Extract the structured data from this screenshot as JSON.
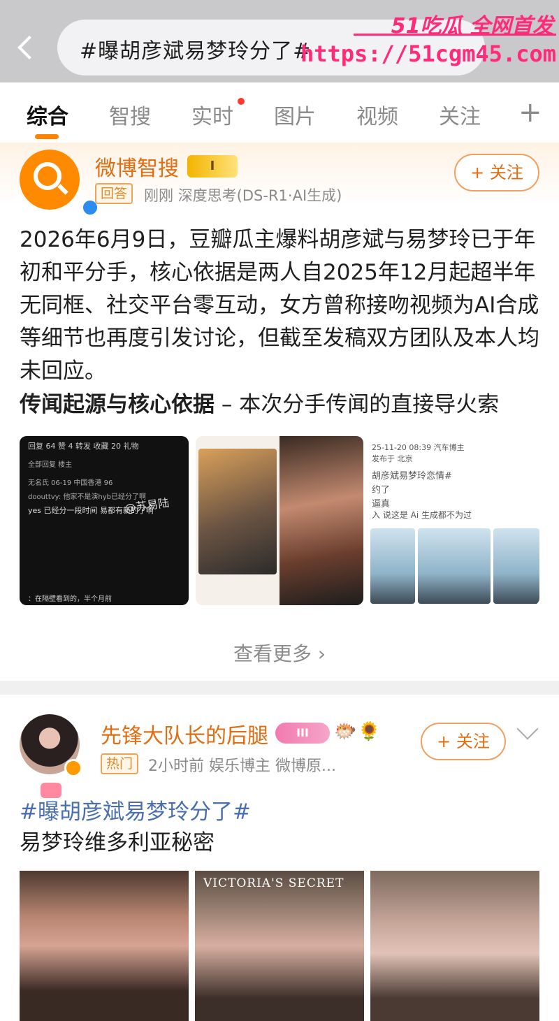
{
  "search": {
    "query": "#曝胡彦斌易梦玲分了#"
  },
  "watermark": {
    "brand": "51吃瓜 全网首发",
    "url": "https://51cgm45.com"
  },
  "tabs": [
    {
      "label": "综合"
    },
    {
      "label": "智搜"
    },
    {
      "label": "实时"
    },
    {
      "label": "图片"
    },
    {
      "label": "视频"
    },
    {
      "label": "关注"
    }
  ],
  "tab_plus": "+",
  "colors": {
    "accent": "#ff8200",
    "name": "#e06d12",
    "hashtag": "#4a6fb0",
    "watermark": "#ff2a7a"
  },
  "post1": {
    "author": "微博智搜",
    "badge": "I",
    "tag": "回答",
    "meta": "刚刚 深度思考(DS-R1·AI生成)",
    "follow_label": "+ 关注",
    "body": "2026年6月9日，豆瓣瓜主爆料胡彦斌与易梦玲已于年初和平分手，核心依据是两人自2025年12月起超半年无同框、社交平台零互动，女方曾称接吻视频为AI合成等细节也再度引发讨论，但截至发稿双方团队及本人均未回应。",
    "section_title": "传闻起源与核心依据",
    "section_rest": " – 本次分手传闻的直接导火索",
    "thumb1": {
      "tabs": "回复 64   赞 4   转发   收藏 20   礼物",
      "row1": "全部回复                                        楼主",
      "row2": "无名氏  06-19  中国香港              96",
      "row3": "doouttvy: 他家不是演hyb已经分了啊",
      "row4": "yes 已经分一段时间 易都有新的了啊",
      "watermark": "@苏易陆",
      "footer": "：在隔壁看到的，半个月前"
    },
    "thumb3": {
      "l1": "25-11-20 08:39  汽车博主",
      "l2": "发布于 北京",
      "l3": "胡彦斌易梦玲恋情#",
      "l4": "约了",
      "l5": "逼真",
      "l6": "入 说这是 Ai 生成都不为过"
    },
    "see_more": "查看更多 ›"
  },
  "post2": {
    "author": "先锋大队长的后腿",
    "level": "III",
    "tag": "热门",
    "meta": "2小时前  娱乐博主 微博原...",
    "follow_label": "+ 关注",
    "hashtag": "#曝胡彦斌易梦玲分了#",
    "caption": "易梦玲维多利亚秘密",
    "image_text": "VICTORIA'S SECRET"
  },
  "icons": {
    "back": "back-arrow-icon",
    "search_brand": "zhisou-logo-icon",
    "verified": "verified-icon",
    "crown": "crown-icon",
    "chevron": "chevron-down-icon"
  }
}
